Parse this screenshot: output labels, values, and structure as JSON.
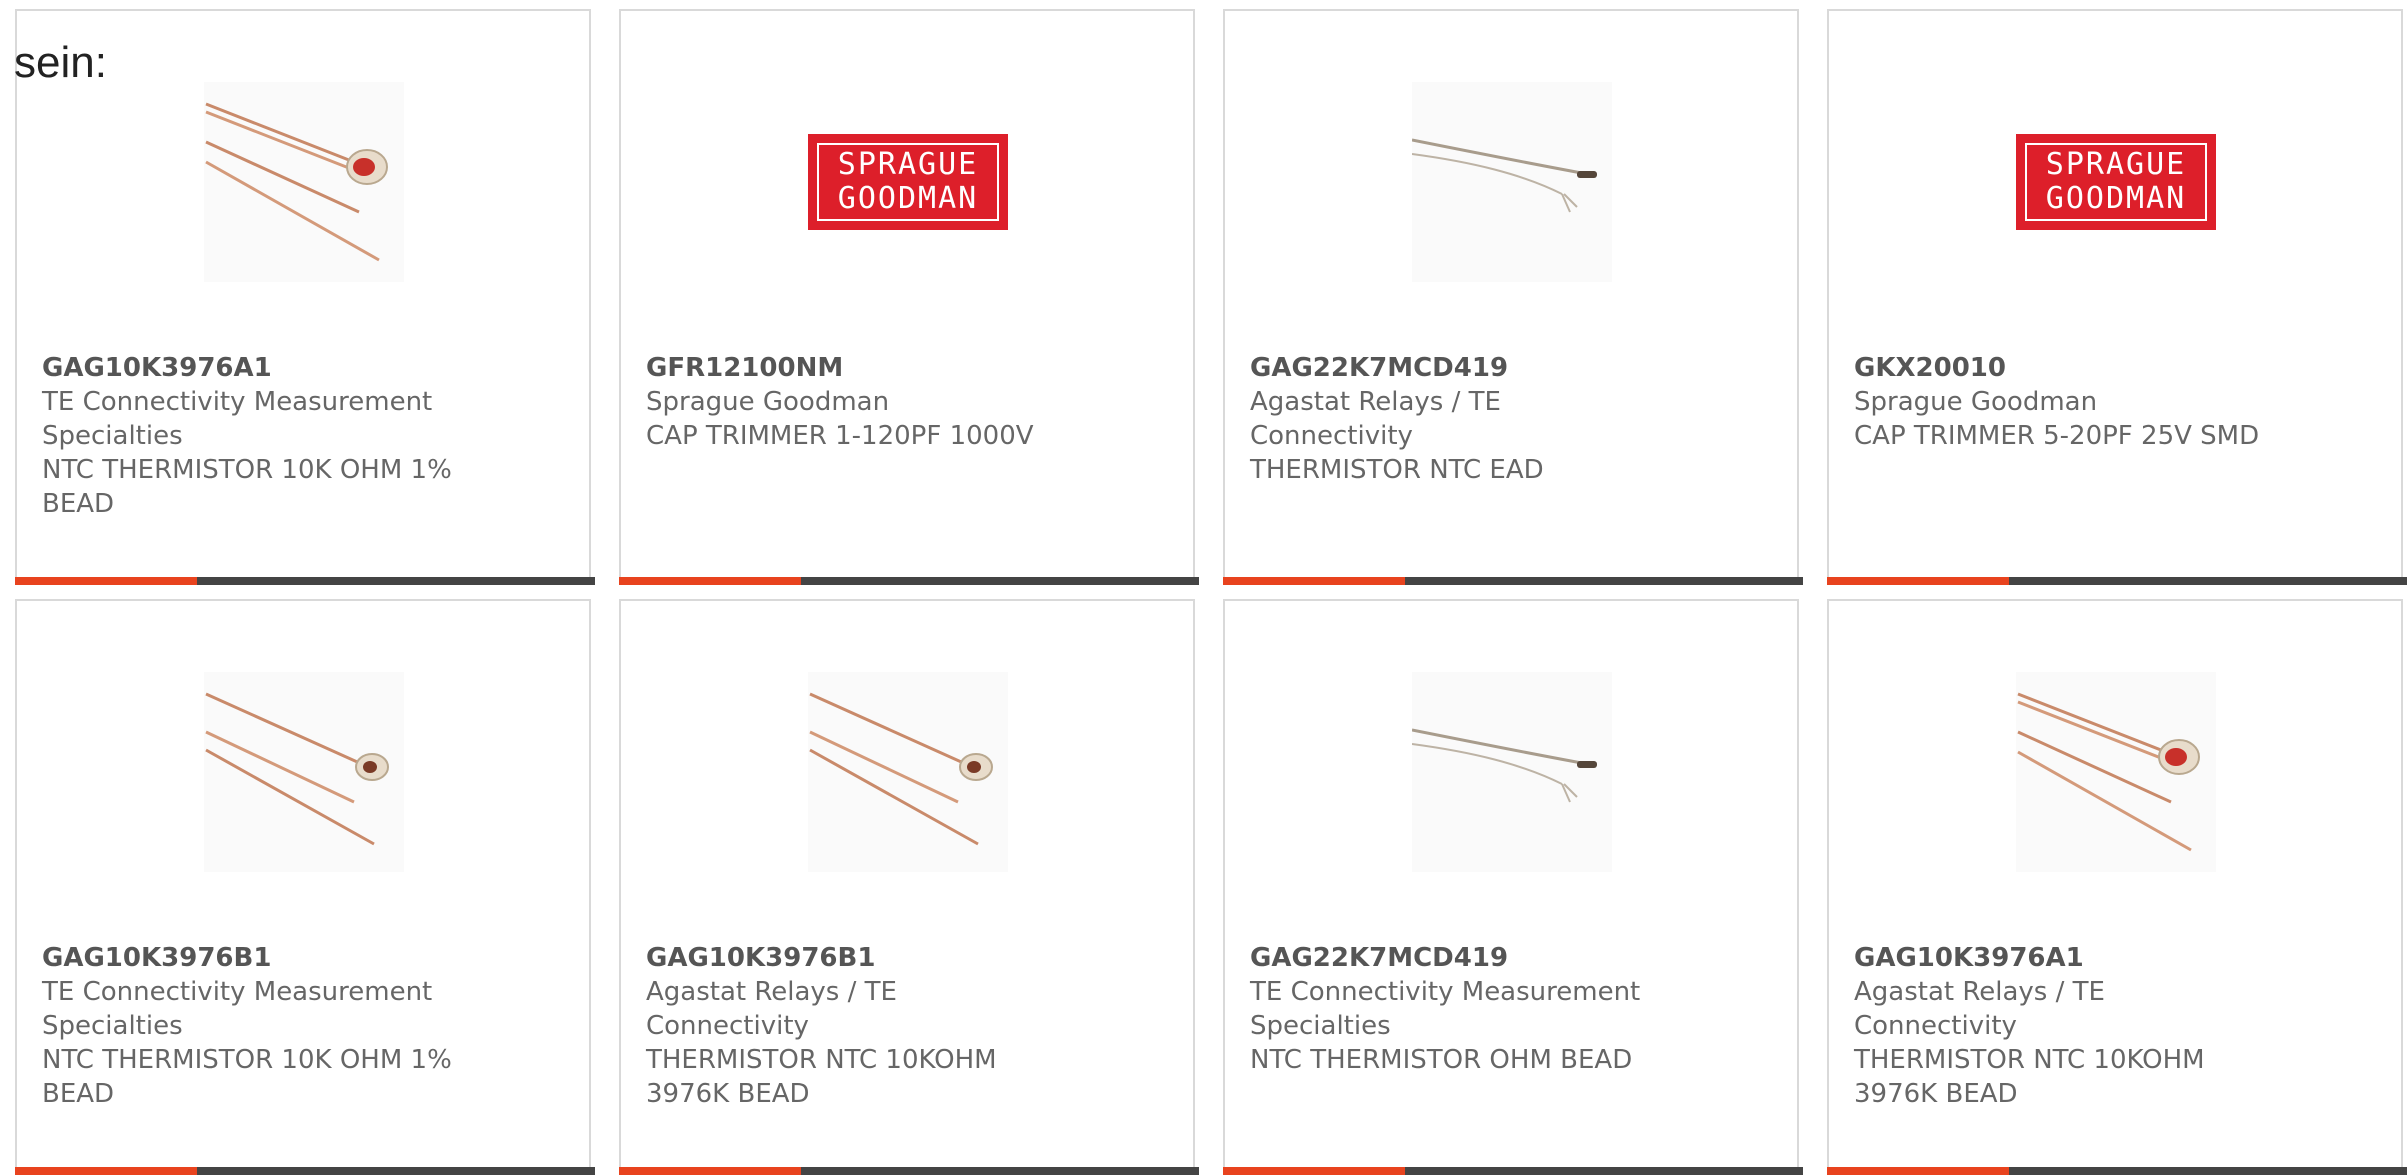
{
  "intro_text": "sein:",
  "colors": {
    "accent": "#e8431e",
    "bar": "#444444",
    "border": "#d9d9d9",
    "text": "#666666",
    "logo_red": "#dd1f2a"
  },
  "products": [
    {
      "part_number": "GAG10K3976A1",
      "manufacturer": "TE Connectivity Measurement Specialties",
      "description": "NTC THERMISTOR 10K OHM 1% BEAD",
      "image": "thermistor-bead-icon"
    },
    {
      "part_number": "GFR12100NM",
      "manufacturer": "Sprague Goodman",
      "description": "CAP TRIMMER 1-120PF 1000V",
      "image": "sprague-goodman-logo",
      "logo_text": "SPRAGUE\nGOODMAN"
    },
    {
      "part_number": "GAG22K7MCD419",
      "manufacturer": "Agastat Relays / TE Connectivity",
      "description": "THERMISTOR NTC EAD",
      "image": "thermistor-probe-icon"
    },
    {
      "part_number": "GKX20010",
      "manufacturer": "Sprague Goodman",
      "description": "CAP TRIMMER 5-20PF 25V SMD",
      "image": "sprague-goodman-logo",
      "logo_text": "SPRAGUE\nGOODMAN"
    },
    {
      "part_number": "GAG10K3976B1",
      "manufacturer": "TE Connectivity Measurement Specialties",
      "description": "NTC THERMISTOR 10K OHM 1% BEAD",
      "image": "thermistor-bead-icon"
    },
    {
      "part_number": "GAG10K3976B1",
      "manufacturer": "Agastat Relays / TE Connectivity",
      "description": "THERMISTOR NTC 10KOHM 3976K BEAD",
      "image": "thermistor-bead-icon"
    },
    {
      "part_number": "GAG22K7MCD419",
      "manufacturer": "TE Connectivity Measurement Specialties",
      "description": "NTC THERMISTOR OHM BEAD",
      "image": "thermistor-probe-icon"
    },
    {
      "part_number": "GAG10K3976A1",
      "manufacturer": "Agastat Relays / TE Connectivity",
      "description": "THERMISTOR NTC 10KOHM 3976K BEAD",
      "image": "thermistor-bead-icon"
    }
  ]
}
